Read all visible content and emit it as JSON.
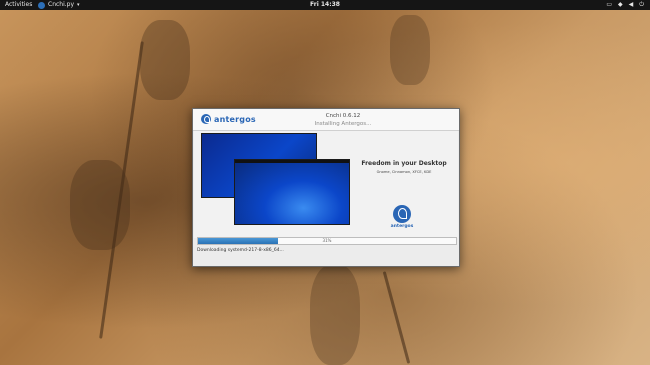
{
  "topbar": {
    "activities": "Activities",
    "app_name": "Cnchi.py",
    "app_menu_caret": "▾",
    "clock": "Fri 14:38",
    "tray_icons": [
      "display-icon",
      "network-icon",
      "volume-icon",
      "power-icon"
    ]
  },
  "window": {
    "logo_text": "antergos",
    "title": "Cnchi 0.6.12",
    "subtitle": "Installing Antergos...",
    "slide": {
      "title": "Freedom in your Desktop",
      "description": "Gnome, Cinnamon, XFCE, KDE",
      "logo_text": "antergos"
    },
    "progress": {
      "value": 31,
      "label": "31%"
    },
    "status": "Downloading systemd-217-8-x86_64..."
  },
  "colors": {
    "topbar_bg": "#151515",
    "accent_blue": "#2a66b5",
    "progress_fill": "#3a86c8"
  }
}
